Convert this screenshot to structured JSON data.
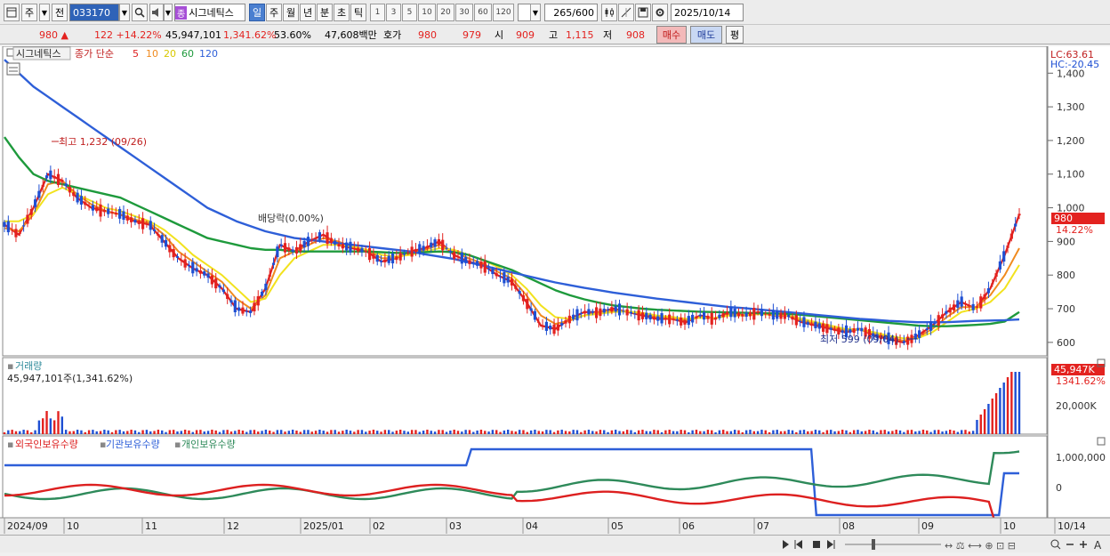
{
  "toolbar": {
    "period_day": "주",
    "prev": "전",
    "code": "033170",
    "stock_tag": "종",
    "stock_name": "시그네틱스",
    "tab_day": "일",
    "tab_week": "주",
    "tab_month": "월",
    "tab_year": "년",
    "tab_min": "분",
    "tab_sec": "초",
    "tab_tick": "틱",
    "nums": [
      "1",
      "3",
      "5",
      "10",
      "20",
      "30",
      "60",
      "120"
    ],
    "count": "265",
    "count_total": "/600",
    "date": "2025/10/14"
  },
  "quote": {
    "price": "980",
    "arrow": "▲",
    "change": "122",
    "change_pct": "+14.22%",
    "volume": "45,947,101",
    "volume_pct": "1,341.62%",
    "turnover_pct": "53.60%",
    "amount": "47,608백만",
    "bid_label": "호가",
    "bid": "980",
    "ask": "979",
    "open_label": "시",
    "open": "909",
    "high_label": "고",
    "high": "1,115",
    "low_label": "저",
    "low": "908",
    "buy": "매수",
    "sell": "매도",
    "eval": "평"
  },
  "price_panel": {
    "legend_name": "시그네틱스",
    "legend_ma": "종가 단순",
    "ma_periods": [
      "5",
      "10",
      "20",
      "60",
      "120"
    ],
    "ma_colors": [
      "#dd2020",
      "#f08a1e",
      "#f2e21e",
      "#1e9a3c",
      "#2e5fd8"
    ],
    "lc": "LC:63.61",
    "hc": "HC:-20.45",
    "y_ticks": [
      "1,400",
      "1,300",
      "1,200",
      "1,100",
      "1,000",
      "900",
      "800",
      "700",
      "600"
    ],
    "high_annot": "최고 1,232 (09/26)",
    "low_annot": "최저 599 (09/04)",
    "dividend_annot": "배당락(0.00%)",
    "current_price": "980",
    "current_pct": "14.22%"
  },
  "volume_panel": {
    "title": "거래량",
    "subtitle": "45,947,101주(1,341.62%)",
    "y_tick": "20,000K",
    "current": "45,947K",
    "current_pct": "1341.62%"
  },
  "holdings_panel": {
    "foreign": "외국인보유수량",
    "institution": "기관보유수량",
    "individual": "개인보유수량",
    "colors": [
      "#dd2020",
      "#2e5fd8",
      "#2e8a5a"
    ],
    "y_ticks": [
      "1,000,000",
      "0"
    ]
  },
  "x_axis": [
    "2024/09",
    "10",
    "11",
    "12",
    "2025/01",
    "02",
    "03",
    "04",
    "05",
    "06",
    "07",
    "08",
    "09",
    "10",
    "10/14"
  ],
  "chart_data": {
    "type": "line",
    "x_start": "2024/09",
    "x_end": "2025/10/14",
    "price_ylim": [
      560,
      1480
    ],
    "series": [
      {
        "name": "5",
        "values": [
          950,
          920,
          1000,
          1100,
          1080,
          1030,
          1000,
          990,
          980,
          960,
          950,
          900,
          850,
          820,
          800,
          760,
          700,
          690,
          760,
          890,
          870,
          900,
          920,
          890,
          880,
          870,
          840,
          850,
          870,
          880,
          900,
          860,
          840,
          830,
          800,
          780,
          720,
          650,
          640,
          670,
          690,
          690,
          700,
          690,
          680,
          670,
          670,
          660,
          680,
          670,
          690,
          680,
          690,
          680,
          680,
          660,
          650,
          640,
          630,
          640,
          620,
          610,
          600,
          620,
          650,
          690,
          720,
          700,
          760,
          860,
          980
        ]
      },
      {
        "name": "10",
        "values": [
          940,
          930,
          980,
          1070,
          1080,
          1040,
          1010,
          990,
          980,
          965,
          955,
          920,
          870,
          840,
          810,
          780,
          730,
          700,
          740,
          850,
          870,
          890,
          910,
          900,
          885,
          875,
          850,
          850,
          865,
          875,
          890,
          870,
          850,
          835,
          810,
          790,
          740,
          680,
          655,
          665,
          680,
          690,
          695,
          692,
          685,
          675,
          672,
          665,
          675,
          672,
          683,
          680,
          686,
          682,
          680,
          665,
          655,
          645,
          635,
          638,
          625,
          615,
          605,
          615,
          640,
          675,
          705,
          705,
          740,
          800,
          880
        ]
      },
      {
        "name": "20",
        "values": [
          960,
          960,
          980,
          1040,
          1060,
          1040,
          1020,
          1000,
          990,
          975,
          960,
          935,
          900,
          860,
          830,
          800,
          760,
          720,
          730,
          800,
          850,
          870,
          890,
          890,
          885,
          875,
          860,
          855,
          860,
          870,
          880,
          875,
          860,
          845,
          825,
          800,
          760,
          710,
          675,
          670,
          680,
          685,
          690,
          692,
          688,
          680,
          676,
          670,
          673,
          672,
          680,
          680,
          684,
          682,
          681,
          670,
          660,
          650,
          640,
          638,
          630,
          620,
          612,
          612,
          630,
          660,
          690,
          700,
          720,
          760,
          830
        ]
      },
      {
        "name": "60",
        "values": [
          1210,
          1150,
          1100,
          1080,
          1070,
          1060,
          1050,
          1040,
          1030,
          1010,
          990,
          970,
          950,
          930,
          910,
          900,
          890,
          880,
          875,
          875,
          870,
          870,
          870,
          870,
          870,
          870,
          868,
          866,
          866,
          868,
          870,
          868,
          860,
          845,
          830,
          815,
          795,
          775,
          755,
          740,
          728,
          718,
          710,
          705,
          700,
          697,
          695,
          693,
          691,
          690,
          689,
          688,
          687,
          686,
          685,
          682,
          678,
          674,
          670,
          666,
          662,
          658,
          654,
          650,
          648,
          648,
          650,
          652,
          655,
          662,
          690
        ]
      },
      {
        "name": "120",
        "values": [
          1440,
          1400,
          1360,
          1330,
          1300,
          1270,
          1240,
          1210,
          1180,
          1150,
          1120,
          1090,
          1060,
          1030,
          1000,
          980,
          960,
          945,
          930,
          920,
          910,
          905,
          900,
          895,
          890,
          885,
          880,
          875,
          870,
          862,
          855,
          848,
          838,
          828,
          818,
          808,
          798,
          788,
          778,
          770,
          762,
          755,
          748,
          742,
          736,
          730,
          725,
          720,
          715,
          710,
          705,
          702,
          698,
          694,
          690,
          686,
          682,
          678,
          674,
          670,
          667,
          664,
          662,
          660,
          660,
          660,
          662,
          664,
          665,
          666,
          668
        ]
      }
    ]
  }
}
